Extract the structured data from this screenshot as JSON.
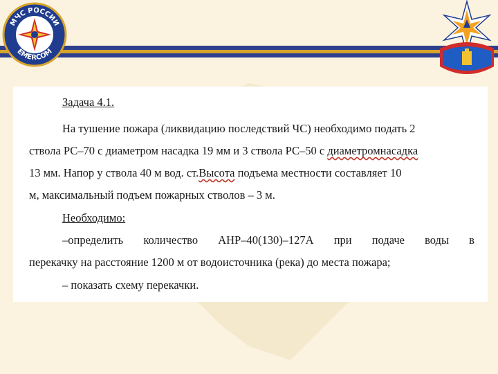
{
  "header": {
    "left_emblem_text_top": "МЧС РОССИИ",
    "left_emblem_text_bottom": "EMERCOM"
  },
  "task": {
    "title": "Задача 4.1.",
    "line1": "На тушение пожара (ликвидацию последствий ЧС) необходимо подать 2",
    "line2_a": "ствола РС–70  с диаметром насадка 19 мм и 3 ствола РС–50 с ",
    "line2_b": "диаметромнасадка",
    "line3_a": "13 мм. Напор у ствола    40 м вод. ст.",
    "line3_b": "Высота",
    "line3_c": " подъема местности составляет 10",
    "line4": "м, максимальный подъем пожарных стволов – 3 м.",
    "required": "Необходимо:",
    "item1_words": [
      "–определить",
      "количество",
      "АНР–40(130)–127А",
      "при",
      "подаче",
      "воды",
      "в"
    ],
    "item1_cont": "перекачку на расстояние 1200 м  от водоисточника (река) до места пожара;",
    "item2": "– показать схему перекачки."
  },
  "colors": {
    "background": "#fbf3df",
    "stripe_blue": "#2d3f8c",
    "stripe_gold": "#d6a42c",
    "emblem_blue": "#1f3c8f",
    "emblem_red": "#d12b2b"
  }
}
